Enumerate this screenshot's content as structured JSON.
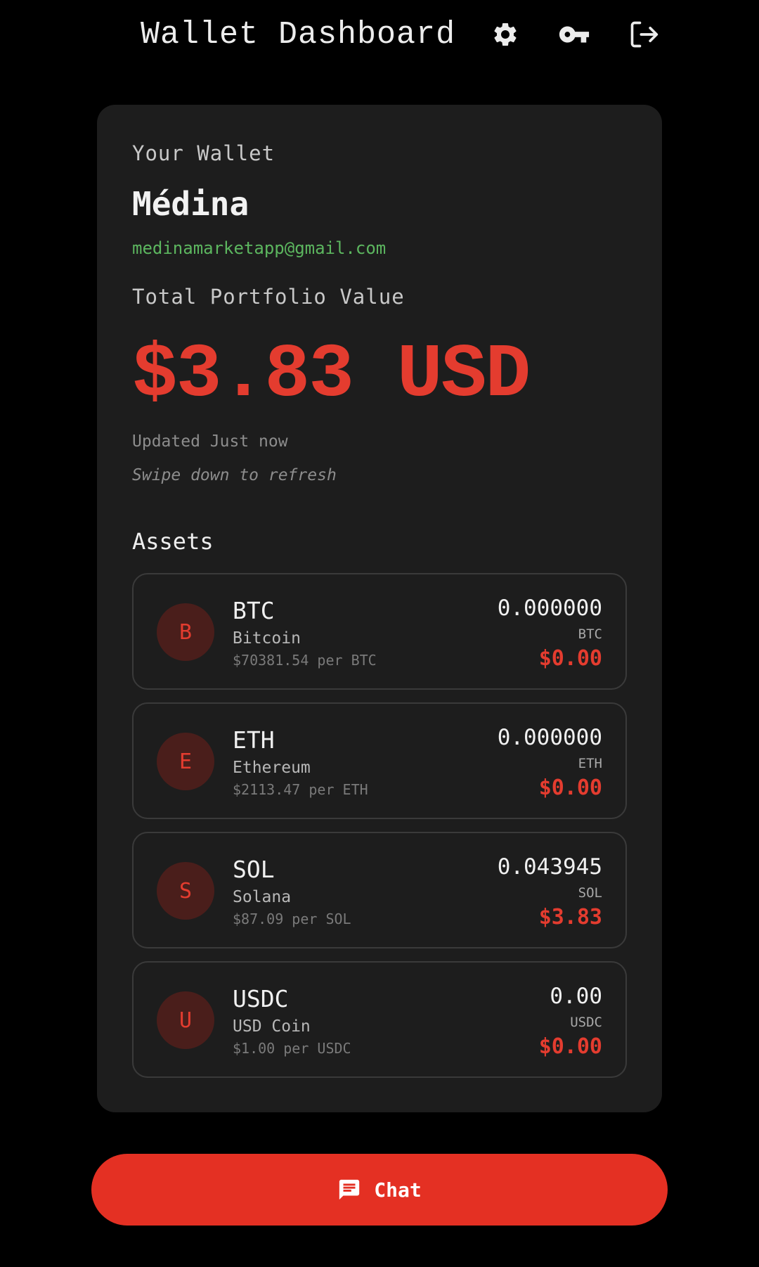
{
  "header": {
    "title": "Wallet Dashboard",
    "icons": [
      "gear-icon",
      "key-icon",
      "logout-icon"
    ]
  },
  "wallet": {
    "label": "Your Wallet",
    "name": "Médina",
    "email": "medinamarketapp@gmail.com",
    "total_label": "Total Portfolio Value",
    "total_value": "$3.83 USD",
    "updated": "Updated Just now",
    "swipe_hint": "Swipe down to refresh",
    "assets_title": "Assets"
  },
  "assets": [
    {
      "initial": "B",
      "symbol": "BTC",
      "name": "Bitcoin",
      "price": "$70381.54 per BTC",
      "amount": "0.000000",
      "unit": "BTC",
      "usd": "$0.00"
    },
    {
      "initial": "E",
      "symbol": "ETH",
      "name": "Ethereum",
      "price": "$2113.47 per ETH",
      "amount": "0.000000",
      "unit": "ETH",
      "usd": "$0.00"
    },
    {
      "initial": "S",
      "symbol": "SOL",
      "name": "Solana",
      "price": "$87.09 per SOL",
      "amount": "0.043945",
      "unit": "SOL",
      "usd": "$3.83"
    },
    {
      "initial": "U",
      "symbol": "USDC",
      "name": "USD Coin",
      "price": "$1.00 per USDC",
      "amount": "0.00",
      "unit": "USDC",
      "usd": "$0.00"
    }
  ],
  "chat": {
    "label": "Chat",
    "icon": "chat-icon"
  },
  "colors": {
    "accent": "#e43c2f",
    "email": "#5cb65f",
    "card_bg": "#1d1d1d",
    "page_bg": "#000000"
  }
}
